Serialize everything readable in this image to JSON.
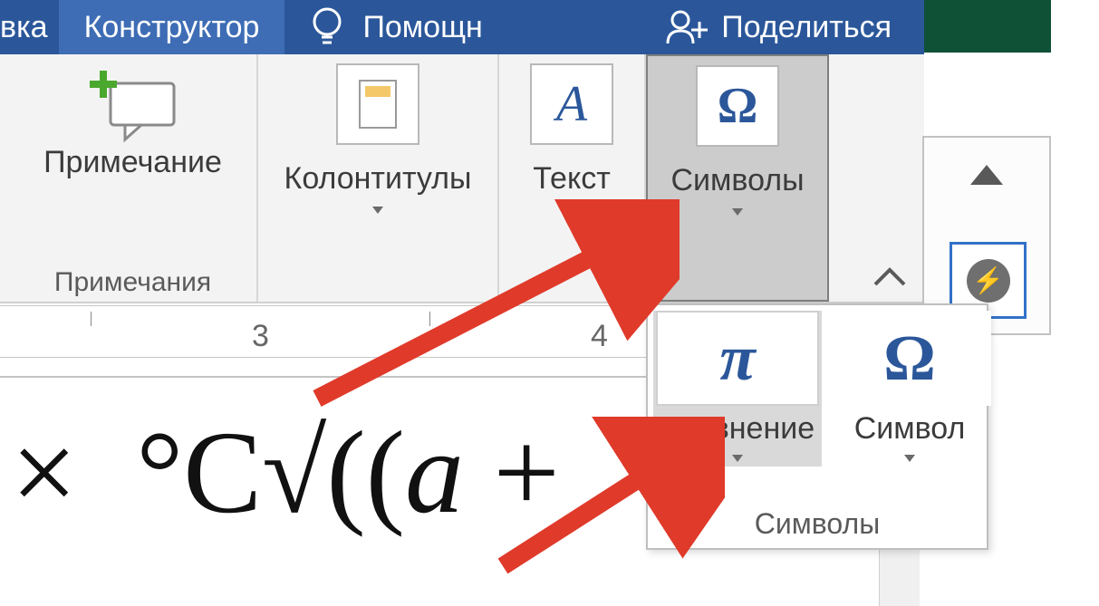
{
  "tabs": {
    "partial_left": "вка",
    "constructor": "Конструктор",
    "help": "Помощн",
    "share": "Поделиться"
  },
  "ribbon": {
    "comment_label": "Примечание",
    "comment_group": "Примечания",
    "headers_label": "Колонтитулы",
    "text_label": "Текст",
    "symbols_label": "Символы"
  },
  "sym_dropdown": {
    "equation": "Уравнение",
    "symbol": "Символ",
    "footer": "Символы",
    "pi_glyph": "π",
    "omega_glyph": "Ω"
  },
  "ruler": {
    "n3": "3",
    "n4": "4"
  },
  "equation_text": "× °C√((a +",
  "icons": {
    "text_glyph": "A",
    "omega_glyph": "Ω",
    "lightning": "⚡"
  }
}
